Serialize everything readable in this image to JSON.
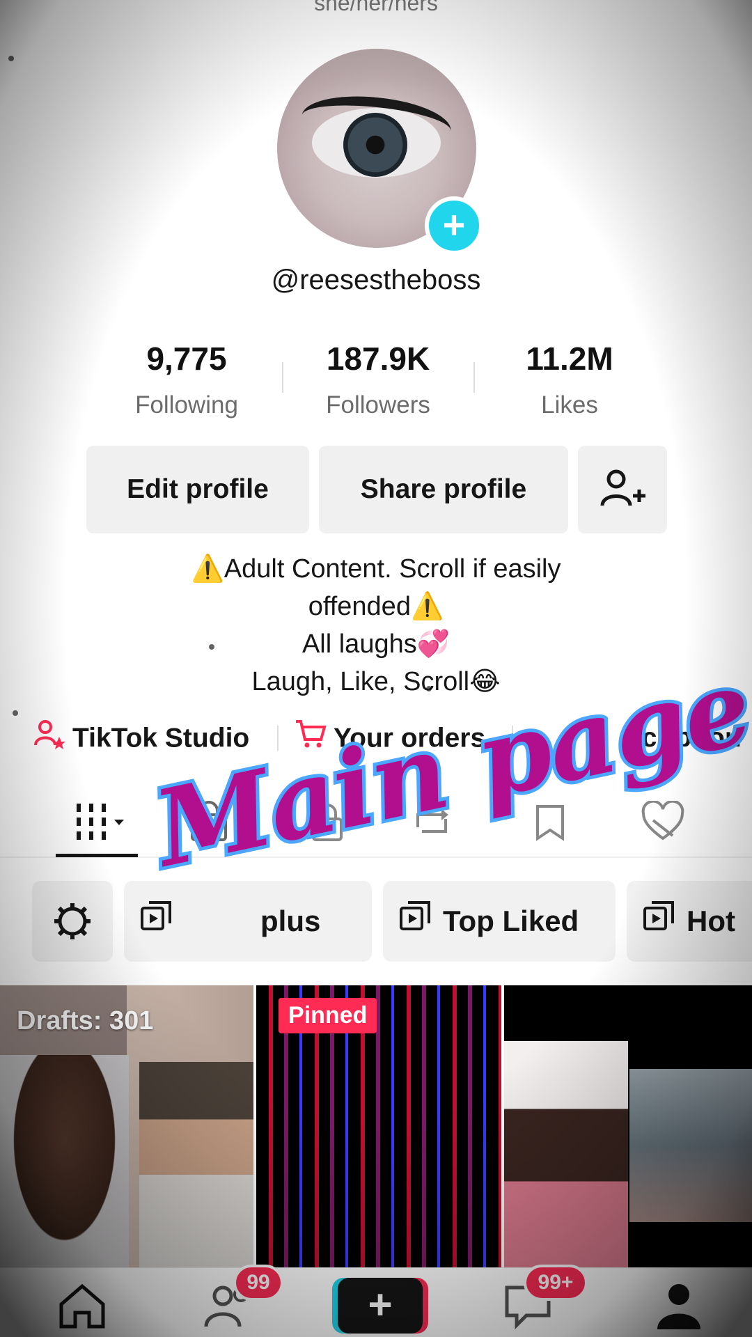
{
  "profile": {
    "pronouns": "she/her/hers",
    "username": "@reesestheboss"
  },
  "stats": [
    {
      "value": "9,775",
      "label": "Following"
    },
    {
      "value": "187.9K",
      "label": "Followers"
    },
    {
      "value": "11.2M",
      "label": "Likes"
    }
  ],
  "actions": {
    "edit": "Edit profile",
    "share": "Share profile",
    "add_friend_icon": "add-user-icon"
  },
  "bio": {
    "line1": "⚠️Adult Content. Scroll if easily",
    "line2": "offended⚠️",
    "line3": "All laughs💞",
    "line4": "Laugh, Like, Scroll😂"
  },
  "links": {
    "studio": "TikTok Studio",
    "orders": "Your orders",
    "subscription": "scription"
  },
  "tabs": [
    "videos-grid-icon",
    "shop-bag-icon",
    "lock-icon",
    "repost-icon",
    "saved-icon",
    "liked-heart-icon"
  ],
  "chips": {
    "plus_label": "plus",
    "top_liked": "Top Liked",
    "hot": "Hot"
  },
  "grid": {
    "drafts": "Drafts: 301",
    "pinned": "Pinned"
  },
  "nav": {
    "friends_badge": "99",
    "inbox_badge": "99+"
  },
  "overlay": {
    "text": "Main page"
  },
  "colors": {
    "accent_pink": "#fe2c55",
    "accent_cyan": "#20d5ec",
    "overlay_fill": "#b10f8e",
    "overlay_stroke": "#4aa6ff"
  }
}
